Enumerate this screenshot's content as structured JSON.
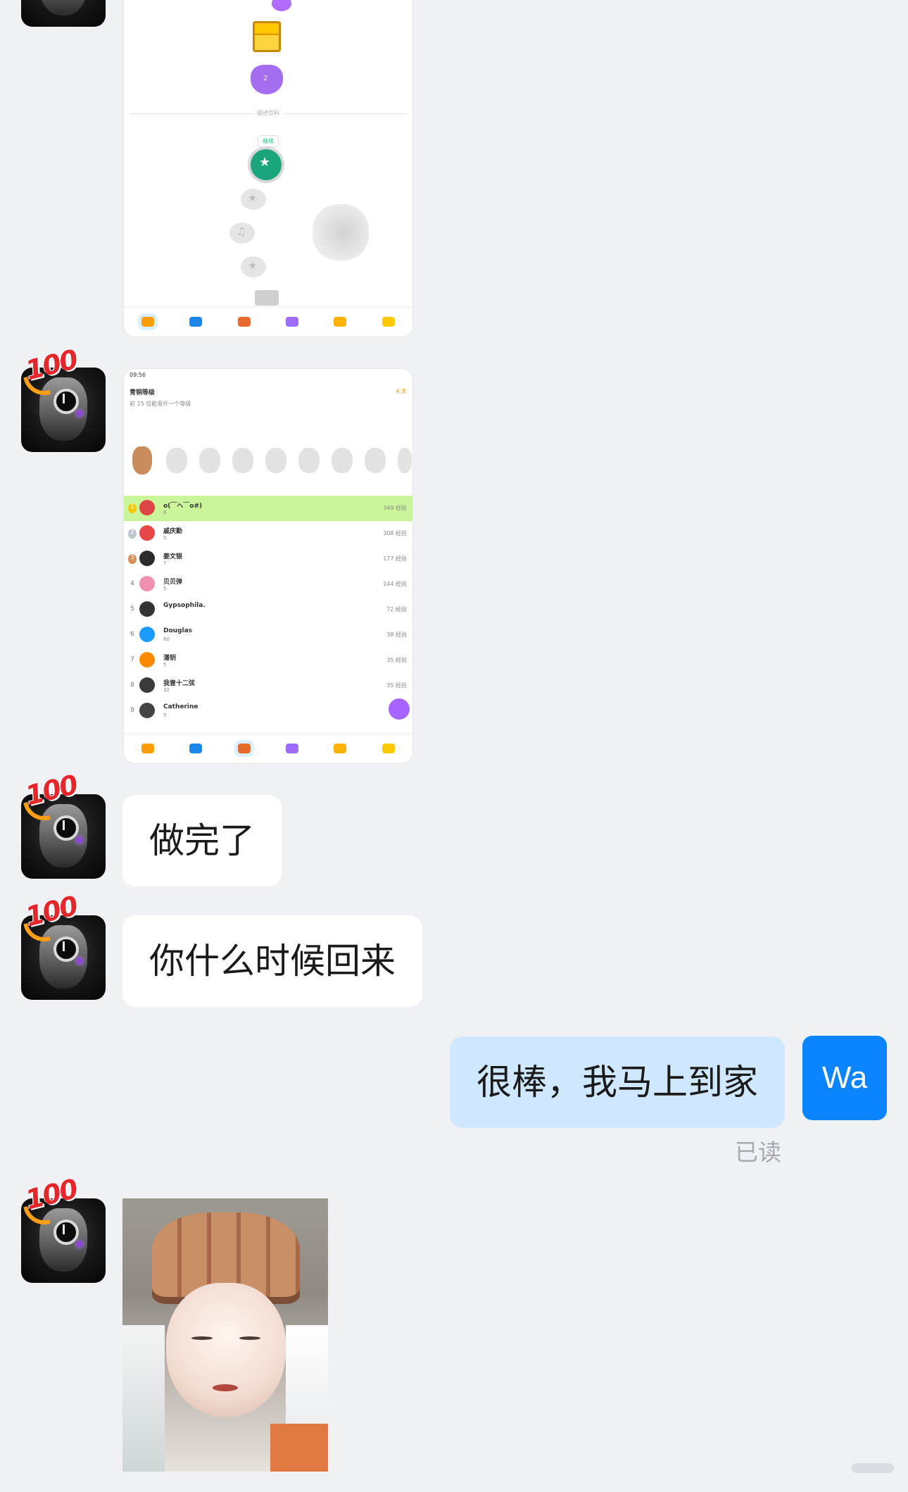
{
  "screenshot1": {
    "section_label": "描述饮料",
    "start_label": "继续",
    "chest_level": "2"
  },
  "screenshot2": {
    "status_time": "09:56",
    "league_title": "青铜等级",
    "league_subtitle": "前 15 位能晋升一个等级",
    "days_left": "4 天",
    "rows": [
      {
        "rank": "1",
        "name": "o(￣ヘ￣o#)",
        "flag": "6",
        "xp": "349 经验"
      },
      {
        "rank": "2",
        "name": "戚庆勤",
        "flag": "5",
        "xp": "308 经验"
      },
      {
        "rank": "3",
        "name": "姜文银",
        "flag": "7",
        "xp": "177 经验"
      },
      {
        "rank": "4",
        "name": "贝贝弹",
        "flag": "5",
        "xp": "144 经验"
      },
      {
        "rank": "5",
        "name": "Gypsophila.",
        "flag": "",
        "xp": "72 经验"
      },
      {
        "rank": "6",
        "name": "Douglas",
        "flag": "60",
        "xp": "38 经验"
      },
      {
        "rank": "7",
        "name": "潘钥",
        "flag": "5",
        "xp": "35 经验"
      },
      {
        "rank": "8",
        "name": "我曾十二弦",
        "flag": "32",
        "xp": "35 经验"
      },
      {
        "rank": "9",
        "name": "Catherine",
        "flag": "5",
        "xp": "3"
      }
    ]
  },
  "messages": {
    "m1": "做完了",
    "m2": "你什么时候回来",
    "m3": "很棒，我马上到家",
    "read_status": "已读",
    "my_avatar_text": "Wa",
    "badge_text": "100"
  }
}
